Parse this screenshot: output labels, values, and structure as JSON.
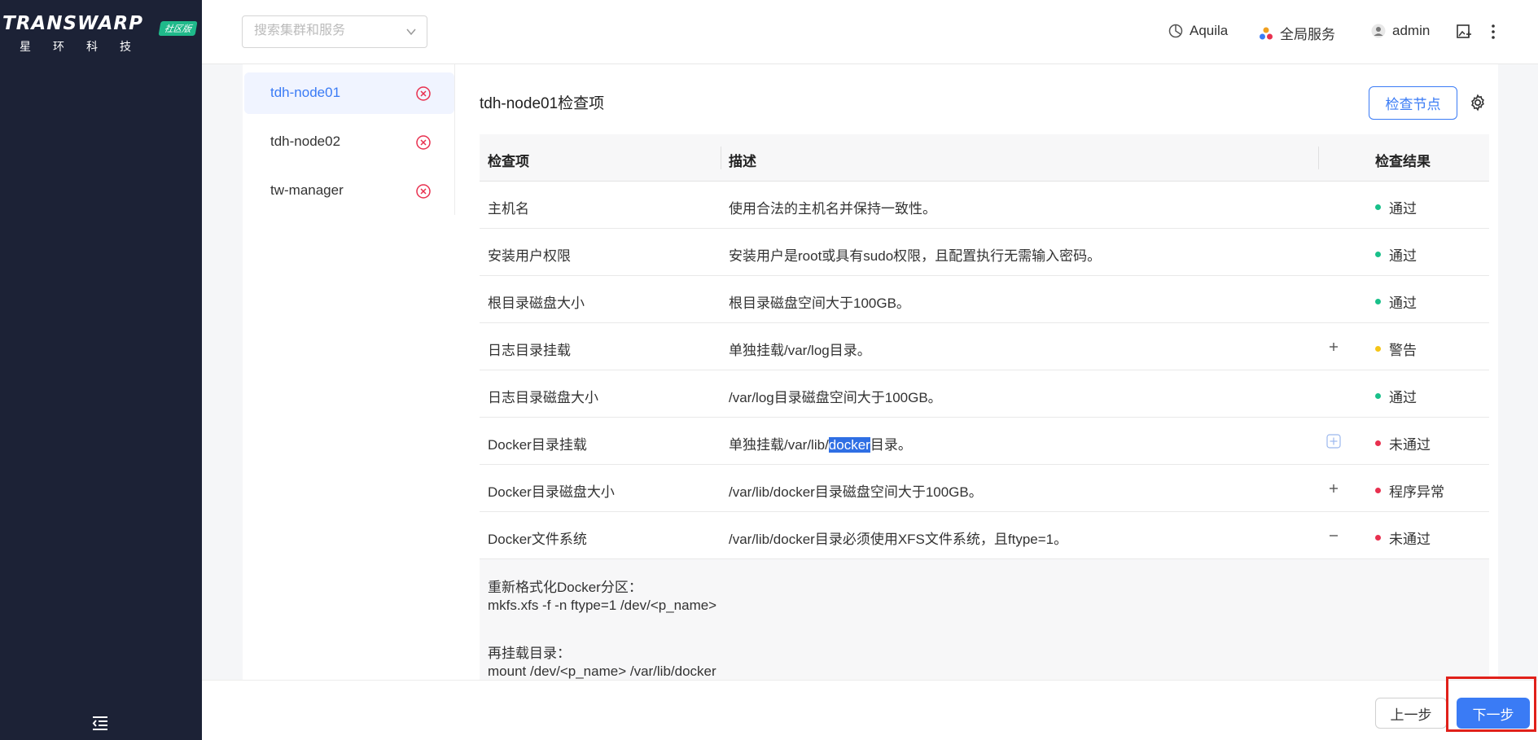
{
  "brand": {
    "logo_text": "TRANSWARP",
    "badge": "社区版",
    "subtitle": "星环科技"
  },
  "header": {
    "search_placeholder": "搜索集群和服务",
    "cluster_name": "Aquila",
    "global_services": "全局服务",
    "user": "admin"
  },
  "nodes": [
    {
      "name": "tdh-node01",
      "active": true
    },
    {
      "name": "tdh-node02",
      "active": false
    },
    {
      "name": "tw-manager",
      "active": false
    }
  ],
  "panel": {
    "title": "tdh-node01检查项",
    "check_button": "检查节点"
  },
  "table": {
    "headers": {
      "item": "检查项",
      "desc": "描述",
      "result": "检查结果"
    },
    "rows": [
      {
        "item": "主机名",
        "desc": "使用合法的主机名并保持一致性。",
        "result": "通过",
        "status": "green",
        "expand": ""
      },
      {
        "item": "安装用户权限",
        "desc": "安装用户是root或具有sudo权限，且配置执行无需输入密码。",
        "result": "通过",
        "status": "green",
        "expand": ""
      },
      {
        "item": "根目录磁盘大小",
        "desc": "根目录磁盘空间大于100GB。",
        "result": "通过",
        "status": "green",
        "expand": ""
      },
      {
        "item": "日志目录挂载",
        "desc": "单独挂载/var/log目录。",
        "result": "警告",
        "status": "yellow",
        "expand": "plus"
      },
      {
        "item": "日志目录磁盘大小",
        "desc": "/var/log目录磁盘空间大于100GB。",
        "result": "通过",
        "status": "green",
        "expand": ""
      },
      {
        "item": "Docker目录挂载",
        "desc_before": "单独挂载/var/lib/",
        "desc_sel": "docker",
        "desc_after": "目录。",
        "result": "未通过",
        "status": "red",
        "expand": "plus-box"
      },
      {
        "item": "Docker目录磁盘大小",
        "desc": "/var/lib/docker目录磁盘空间大于100GB。",
        "result": "程序异常",
        "status": "red",
        "expand": "plus"
      },
      {
        "item": "Docker文件系统",
        "desc": "/var/lib/docker目录必须使用XFS文件系统，且ftype=1。",
        "result": "未通过",
        "status": "red",
        "expand": "minus"
      }
    ],
    "detail": {
      "line1": "重新格式化Docker分区：",
      "line2": "mkfs.xfs -f -n ftype=1 /dev/<p_name>",
      "line3": "再挂载目录：",
      "line4": "mount /dev/<p_name> /var/lib/docker"
    }
  },
  "footer": {
    "prev": "上一步",
    "next": "下一步"
  },
  "colors": {
    "accent": "#3a7bf5",
    "sidebar": "#1c2236",
    "pass": "#19c08a",
    "warn": "#f5c518",
    "fail": "#e8304f"
  }
}
